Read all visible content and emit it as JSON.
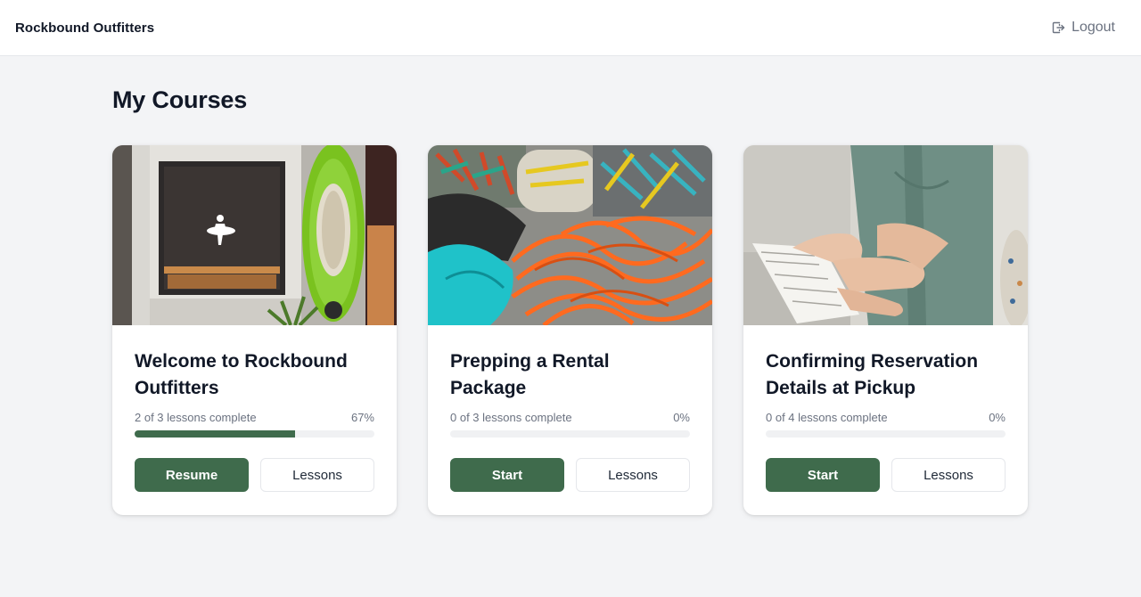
{
  "header": {
    "brand": "Rockbound Outfitters",
    "logout_label": "Logout",
    "logout_icon": "logout-icon"
  },
  "page": {
    "title": "My Courses"
  },
  "colors": {
    "accent": "#3f6b4c",
    "background": "#f3f4f6",
    "track": "#f0f1f3"
  },
  "courses": [
    {
      "title": "Welcome to Rockbound Outfitters",
      "progress_text": "2 of 3 lessons complete",
      "percent_text": "67%",
      "progress": 0.67,
      "primary_label": "Resume",
      "secondary_label": "Lessons",
      "image": "storefront-with-kayak"
    },
    {
      "title": "Prepping a Rental Package",
      "progress_text": "0 of 3 lessons complete",
      "percent_text": "0%",
      "progress": 0,
      "primary_label": "Start",
      "secondary_label": "Lessons",
      "image": "climbing-gear-and-rope"
    },
    {
      "title": "Confirming Reservation Details at Pickup",
      "progress_text": "0 of 4 lessons complete",
      "percent_text": "0%",
      "progress": 0,
      "primary_label": "Start",
      "secondary_label": "Lessons",
      "image": "person-reviewing-paperwork"
    }
  ]
}
